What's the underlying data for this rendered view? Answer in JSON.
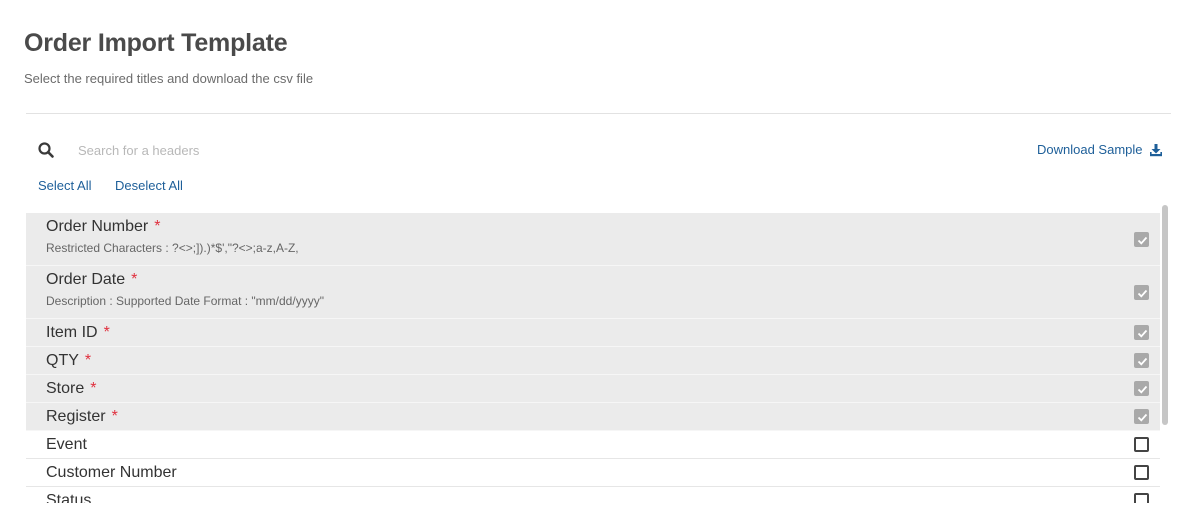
{
  "header": {
    "title": "Order Import Template",
    "subtitle": "Select the required titles and download the csv file"
  },
  "toolbar": {
    "search_placeholder": "Search for a headers",
    "search_value": "",
    "search_icon": "search-icon",
    "download_label": "Download Sample",
    "download_icon": "download-icon",
    "select_all_label": "Select All",
    "deselect_all_label": "Deselect All"
  },
  "colors": {
    "link": "#1e5f99",
    "required_star": "#e0303e",
    "required_row_bg": "#ebebeb",
    "checked_box": "#a9a9a9"
  },
  "fields": [
    {
      "title": "Order Number",
      "required": true,
      "star": "*",
      "description": "Restricted Characters : ?<>;]).)*$',\"?<>;a-z,A-Z,",
      "checked": true
    },
    {
      "title": "Order Date",
      "required": true,
      "star": "*",
      "description": "Description : Supported Date Format : \"mm/dd/yyyy\"",
      "checked": true
    },
    {
      "title": "Item ID",
      "required": true,
      "star": "*",
      "description": "",
      "checked": true
    },
    {
      "title": "QTY",
      "required": true,
      "star": "*",
      "description": "",
      "checked": true
    },
    {
      "title": "Store",
      "required": true,
      "star": "*",
      "description": "",
      "checked": true
    },
    {
      "title": "Register",
      "required": true,
      "star": "*",
      "description": "",
      "checked": true
    },
    {
      "title": "Event",
      "required": false,
      "star": "",
      "description": "",
      "checked": false
    },
    {
      "title": "Customer Number",
      "required": false,
      "star": "",
      "description": "",
      "checked": false
    },
    {
      "title": "Status",
      "required": false,
      "star": "",
      "description": "",
      "checked": false
    }
  ]
}
